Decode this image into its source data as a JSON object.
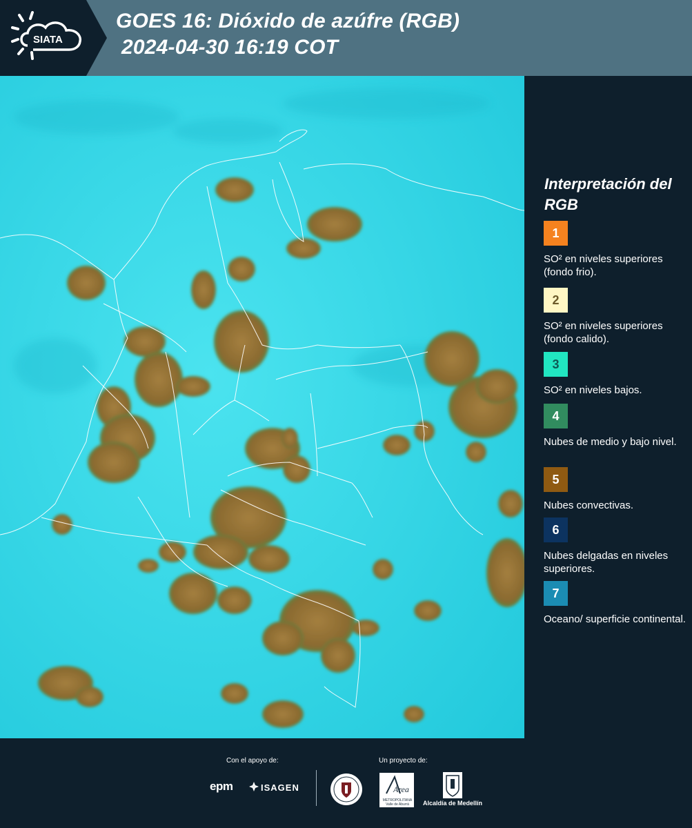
{
  "header": {
    "logo_text": "SIATA",
    "title_line1": "GOES 16: Dióxido de azúfre (RGB)",
    "title_line2": "2024-04-30 16:19 COT"
  },
  "legend": {
    "title": "Interpretación del RGB",
    "items": [
      {
        "number": "1",
        "color": "#f5821f",
        "label": "SO² en niveles superiores (fondo frio)."
      },
      {
        "number": "2",
        "color": "#fff7c4",
        "label": "SO² en niveles superiores (fondo calido)."
      },
      {
        "number": "3",
        "color": "#21e6c1",
        "label": "SO² en niveles bajos."
      },
      {
        "number": "4",
        "color": "#318c5f",
        "label": "Nubes de medio y bajo nivel."
      },
      {
        "number": "5",
        "color": "#8f5a12",
        "label": "Nubes convectivas."
      },
      {
        "number": "6",
        "color": "#0c3360",
        "label": "Nubes delgadas en niveles superiores."
      },
      {
        "number": "7",
        "color": "#1b8cb3",
        "label": "Oceano/ superficie continental."
      }
    ]
  },
  "footer": {
    "support_label": "Con el apoyo de:",
    "project_label": "Un proyecto de:",
    "sponsor_1": "epm",
    "sponsor_2": "ISAGEN",
    "partner_area": "Área",
    "partner_area_sub": "METROPOLITANA Valle de Aburrá",
    "partner_alcaldia": "Alcaldía de Medellín"
  },
  "colors": {
    "header_bg": "#4f7282",
    "panel_bg": "#0e1f2c",
    "map_background": "#2fd6e3",
    "cloud": "#9c7a3c"
  }
}
